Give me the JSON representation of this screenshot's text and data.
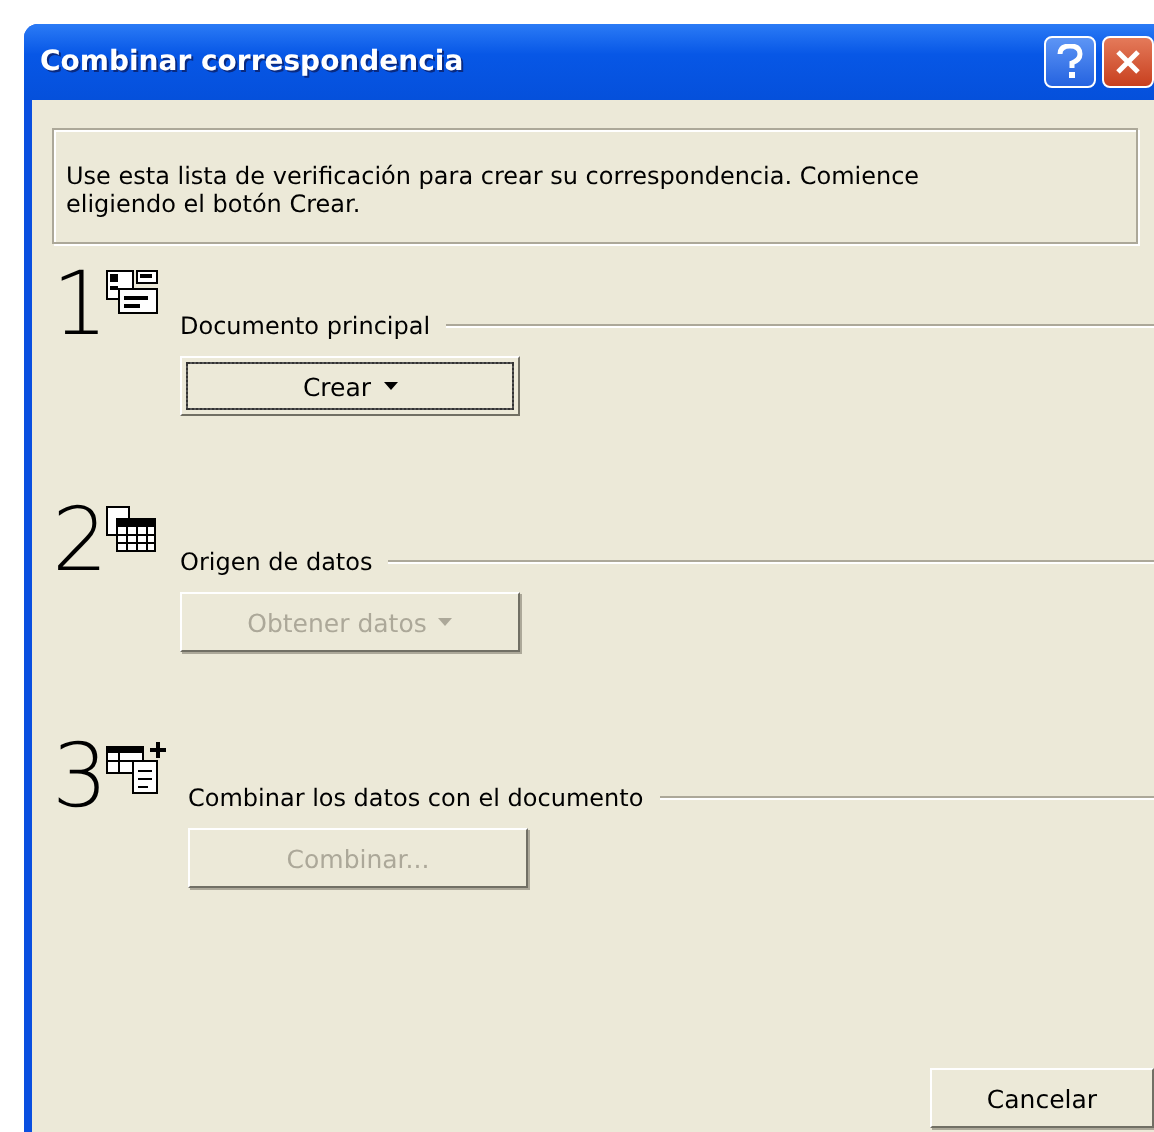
{
  "window": {
    "title": "Combinar correspondencia"
  },
  "intro": "Use esta lista de verificación para crear su correspondencia. Comience eligiendo el botón Crear.",
  "steps": [
    {
      "number": "1",
      "kind": "document",
      "label": "Documento principal",
      "button": {
        "label": "Crear",
        "dropdown": true,
        "disabled": false,
        "focused": true
      }
    },
    {
      "number": "2",
      "kind": "data",
      "label": "Origen de datos",
      "button": {
        "label": "Obtener datos",
        "dropdown": true,
        "disabled": true,
        "focused": false
      }
    },
    {
      "number": "3",
      "kind": "merge",
      "label": "Combinar los datos con el documento",
      "button": {
        "label": "Combinar...",
        "dropdown": false,
        "disabled": true,
        "focused": false
      }
    }
  ],
  "buttons": [
    "Cancelar"
  ]
}
